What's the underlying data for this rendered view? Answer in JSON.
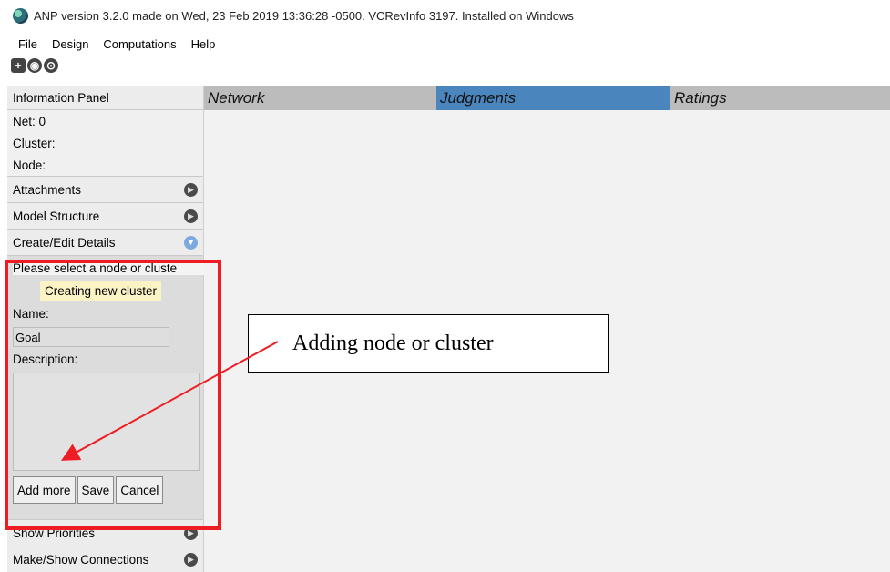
{
  "window": {
    "title": "ANP version 3.2.0 made on Wed, 23 Feb 2019 13:36:28 -0500.  VCRevInfo 3197.  Installed on Windows"
  },
  "menu": [
    "File",
    "Design",
    "Computations",
    "Help"
  ],
  "toolbar": {
    "icons": [
      "add-icon",
      "eye-icon",
      "search-icon"
    ]
  },
  "sidebar": {
    "header": "Information Panel",
    "info": {
      "net": "Net: 0",
      "cluster": "Cluster:",
      "node": "Node:"
    },
    "sections": [
      "Attachments",
      "Model Structure",
      "Create/Edit Details"
    ],
    "footer_sections": [
      "Show Priorities",
      "Make/Show Connections"
    ]
  },
  "edit": {
    "message": "Please select a node or cluste",
    "status": "Creating new cluster",
    "name_label": "Name:",
    "name_value": "Goal",
    "desc_label": "Description:",
    "buttons": [
      "Add more",
      "Save",
      "Cancel"
    ]
  },
  "tabs": [
    {
      "label": "Network",
      "active": false
    },
    {
      "label": "Judgments",
      "active": true
    },
    {
      "label": "Ratings",
      "active": false
    }
  ],
  "annotation": {
    "text": "Adding node or cluster",
    "color": "#ee1d23"
  },
  "colors": {
    "active_tab": "#4a86bd",
    "tab": "#bcbcbc",
    "highlight": "#ee1d23",
    "status_bg": "#fbf3c4"
  }
}
